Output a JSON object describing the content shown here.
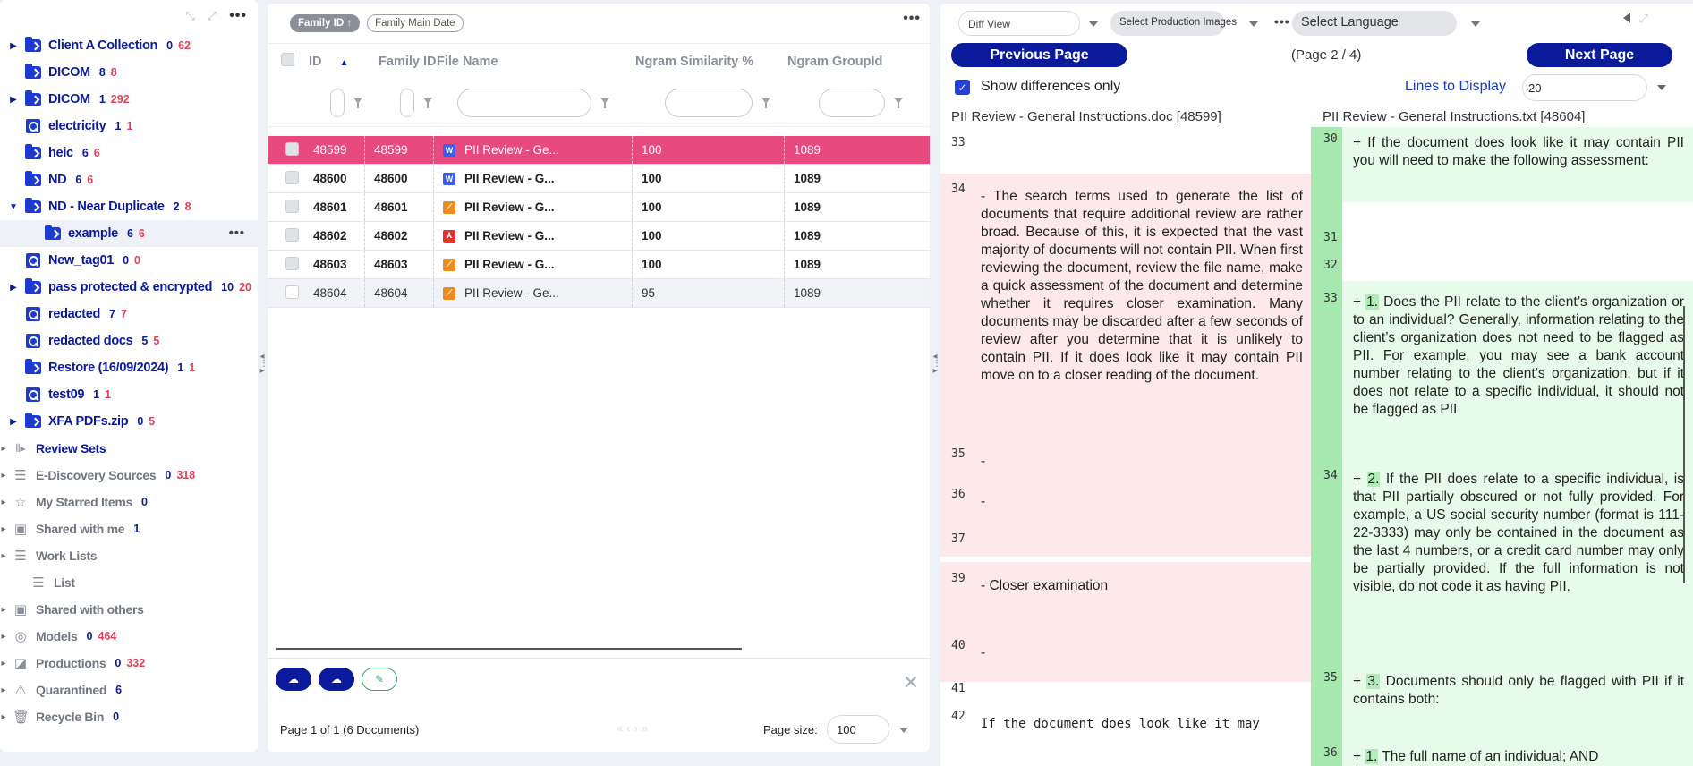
{
  "sidebar": {
    "top_dots": "•••",
    "items": [
      {
        "label": "Client A Collection",
        "c1": "0",
        "c2": "62",
        "type": "folder",
        "caret": "right"
      },
      {
        "label": "DICOM",
        "c1": "8",
        "c2": "8",
        "type": "folder",
        "caret": ""
      },
      {
        "label": "DICOM",
        "c1": "1",
        "c2": "292",
        "type": "folder",
        "caret": "right"
      },
      {
        "label": "electricity",
        "c1": "1",
        "c2": "1",
        "type": "search",
        "caret": ""
      },
      {
        "label": "heic",
        "c1": "6",
        "c2": "6",
        "type": "folder",
        "caret": ""
      },
      {
        "label": "ND",
        "c1": "6",
        "c2": "6",
        "type": "folder",
        "caret": ""
      },
      {
        "label": "ND - Near Duplicate",
        "c1": "2",
        "c2": "8",
        "type": "folder",
        "caret": "down"
      },
      {
        "label": "example",
        "c1": "6",
        "c2": "6",
        "type": "folder",
        "caret": "",
        "selected": true,
        "indent": true
      },
      {
        "label": "New_tag01",
        "c1": "0",
        "c2": "0",
        "type": "search",
        "caret": ""
      },
      {
        "label": "pass protected & encrypted",
        "c1": "10",
        "c2": "20",
        "type": "folder",
        "caret": "right"
      },
      {
        "label": "redacted",
        "c1": "7",
        "c2": "7",
        "type": "search",
        "caret": ""
      },
      {
        "label": "redacted docs",
        "c1": "5",
        "c2": "5",
        "type": "search",
        "caret": ""
      },
      {
        "label": "Restore (16/09/2024)",
        "c1": "1",
        "c2": "1",
        "type": "folder",
        "caret": ""
      },
      {
        "label": "test09",
        "c1": "1",
        "c2": "1",
        "type": "search",
        "caret": ""
      },
      {
        "label": "XFA PDFs.zip",
        "c1": "0",
        "c2": "5",
        "type": "folder",
        "caret": "right"
      }
    ],
    "sections": [
      {
        "label": "Review Sets",
        "icon": "review-sets-icon",
        "glyph": "⫴▸",
        "c1": "",
        "c2": "",
        "blue": true
      },
      {
        "label": "E-Discovery Sources",
        "icon": "database-icon",
        "glyph": "☰",
        "c1": "0",
        "c2": "318"
      },
      {
        "label": "My Starred Items",
        "icon": "star-icon",
        "glyph": "☆",
        "c1": "0",
        "c2": ""
      },
      {
        "label": "Shared with me",
        "icon": "shared-folder-icon",
        "glyph": "▣",
        "c1": "1",
        "c2": ""
      },
      {
        "label": "Work Lists",
        "icon": "list-icon",
        "glyph": "☰",
        "c1": "",
        "c2": ""
      },
      {
        "label": "List",
        "icon": "list-icon",
        "glyph": "☰",
        "c1": "",
        "c2": "",
        "indent": true
      },
      {
        "label": "Shared with others",
        "icon": "shared-folder-icon",
        "glyph": "▣",
        "c1": "",
        "c2": ""
      },
      {
        "label": "Models",
        "icon": "fingerprint-icon",
        "glyph": "◎",
        "c1": "0",
        "c2": "464"
      },
      {
        "label": "Productions",
        "icon": "production-icon",
        "glyph": "◪",
        "c1": "0",
        "c2": "332"
      },
      {
        "label": "Quarantined",
        "icon": "warning-icon",
        "glyph": "⚠",
        "c1": "6",
        "c2": ""
      },
      {
        "label": "Recycle Bin",
        "icon": "trash-icon",
        "glyph": "🗑",
        "c1": "0",
        "c2": ""
      }
    ]
  },
  "docs": {
    "sort_chips": [
      "Family ID ↑",
      "Family Main Date"
    ],
    "columns": [
      "ID",
      "Family ID",
      "File Name",
      "Ngram Similarity %",
      "Ngram GroupId"
    ],
    "rows": [
      {
        "id": "48599",
        "family": "48599",
        "name": "PII Review - Ge...",
        "sim": "100",
        "group": "1089",
        "ftype": "word",
        "style": "hl"
      },
      {
        "id": "48600",
        "family": "48600",
        "name": "PII Review - G...",
        "sim": "100",
        "group": "1089",
        "ftype": "word",
        "style": "bold"
      },
      {
        "id": "48601",
        "family": "48601",
        "name": "PII Review - G...",
        "sim": "100",
        "group": "1089",
        "ftype": "txt",
        "style": "bold"
      },
      {
        "id": "48602",
        "family": "48602",
        "name": "PII Review - G...",
        "sim": "100",
        "group": "1089",
        "ftype": "pdf",
        "style": "bold"
      },
      {
        "id": "48603",
        "family": "48603",
        "name": "PII Review - G...",
        "sim": "100",
        "group": "1089",
        "ftype": "txt",
        "style": "bold"
      },
      {
        "id": "48604",
        "family": "48604",
        "name": "PII Review - Ge...",
        "sim": "95",
        "group": "1089",
        "ftype": "txt",
        "style": "gray"
      }
    ],
    "page_info": "Page 1 of 1 (6 Documents)",
    "page_size_label": "Page size:",
    "page_size": "100"
  },
  "viewer": {
    "mode": "Diff View",
    "production": "Select Production Images",
    "language": "Select Language",
    "prev": "Previous Page",
    "next": "Next Page",
    "page": "(Page 2 / 4)",
    "show_diff": "Show differences only",
    "lines_label": "Lines to Display",
    "lines_value": "20",
    "left_file": "PII Review - General Instructions.doc [48599]",
    "right_file": "PII Review - General Instructions.txt [48604]",
    "left_lines": [
      {
        "n": "33",
        "text": ""
      },
      {
        "n": "34",
        "text": "- The search terms used to generate the list of documents that require additional review are rather broad. Because of this, it is expected that the vast majority of documents will not contain PII. When first reviewing the document, review the file name, make a quick assessment of the document and determine whether it requires closer examination. Many documents may be discarded after a few seconds of review after you determine that it is unlikely to contain PII. If it does look like it may contain PII move on to a closer reading of the document."
      },
      {
        "n": "35",
        "text": "-"
      },
      {
        "n": "36",
        "text": "-"
      },
      {
        "n": "37",
        "text": ""
      },
      {
        "n": "39",
        "text": "- Closer examination"
      },
      {
        "n": "40",
        "text": "-"
      },
      {
        "n": "41",
        "text": ""
      },
      {
        "n": "42",
        "text": "If the document does look like it may"
      }
    ],
    "right_lines": [
      {
        "n": "30",
        "text": "+ If the document does look like it may contain PII you will need to make the following assessment:"
      },
      {
        "n": "31",
        "text": ""
      },
      {
        "n": "32",
        "text": ""
      },
      {
        "n": "33",
        "pre": "+ ",
        "num": "1.",
        "text": " Does the PII relate to the client’s organization or to an individual? Generally, information relating to the client’s organization does not need to be flagged as PII. For example, you may see a bank account number relating to the client’s organization, but if it does not relate to a specific individual, it should not be flagged as PII"
      },
      {
        "n": "34",
        "pre": "+ ",
        "num": "2.",
        "text": " If the PII does relate to a specific individual, is that PII partially obscured or not fully provided. For example, a US social security number (format is 111-22-3333) may only be contained in the document as the last 4 numbers, or a credit card number may only be partially provided. If the full information is not visible, do not code it as having PII."
      },
      {
        "n": "35",
        "pre": "+ ",
        "num": "3.",
        "text": " Documents should only be flagged with PII if it contains both:"
      },
      {
        "n": "36",
        "pre": "+ ",
        "num": "1.",
        "text": " The full name of an individual; AND"
      }
    ]
  },
  "colors": {
    "accent": "#0a1a9a",
    "highlight_row": "#e8497e",
    "removed_bg": "#fde8ea",
    "added_bg": "#e6fbe8"
  }
}
